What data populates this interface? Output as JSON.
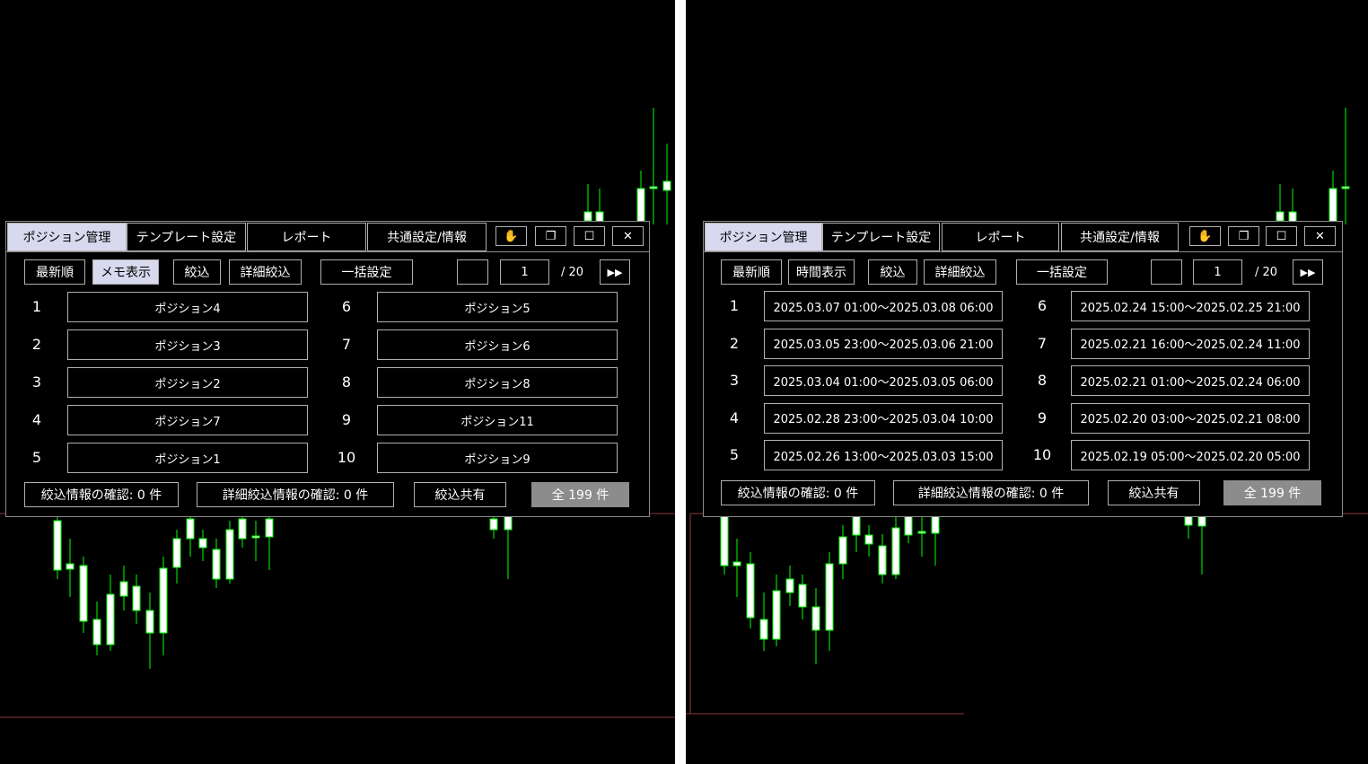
{
  "left": {
    "tabs": [
      "ポジション管理",
      "テンプレート設定",
      "レポート",
      "共通設定/情報"
    ],
    "toolbar": {
      "sort": "最新順",
      "display": "メモ表示",
      "filter": "絞込",
      "detail_filter": "詳細絞込",
      "bulk": "一括設定",
      "page_current": "1",
      "page_total": "/ 20"
    },
    "rows_left": [
      {
        "num": "1",
        "label": "ポジション4"
      },
      {
        "num": "2",
        "label": "ポジション3"
      },
      {
        "num": "3",
        "label": "ポジション2"
      },
      {
        "num": "4",
        "label": "ポジション7"
      },
      {
        "num": "5",
        "label": "ポジション1"
      }
    ],
    "rows_right": [
      {
        "num": "6",
        "label": "ポジション5"
      },
      {
        "num": "7",
        "label": "ポジション6"
      },
      {
        "num": "8",
        "label": "ポジション8"
      },
      {
        "num": "9",
        "label": "ポジション11"
      },
      {
        "num": "10",
        "label": "ポジション9"
      }
    ],
    "footer": {
      "filter_info": "絞込情報の確認: 0 件",
      "detail_info": "詳細絞込情報の確認: 0 件",
      "share": "絞込共有",
      "total": "全 199 件"
    }
  },
  "right": {
    "tabs": [
      "ポジション管理",
      "テンプレート設定",
      "レポート",
      "共通設定/情報"
    ],
    "toolbar": {
      "sort": "最新順",
      "display": "時間表示",
      "filter": "絞込",
      "detail_filter": "詳細絞込",
      "bulk": "一括設定",
      "page_current": "1",
      "page_total": "/ 20"
    },
    "rows_left": [
      {
        "num": "1",
        "label": "2025.03.07 01:00～2025.03.08 06:00"
      },
      {
        "num": "2",
        "label": "2025.03.05 23:00～2025.03.06 21:00"
      },
      {
        "num": "3",
        "label": "2025.03.04 01:00～2025.03.05 06:00"
      },
      {
        "num": "4",
        "label": "2025.02.28 23:00～2025.03.04 10:00"
      },
      {
        "num": "5",
        "label": "2025.02.26 13:00～2025.03.03 15:00"
      }
    ],
    "rows_right": [
      {
        "num": "6",
        "label": "2025.02.24 15:00～2025.02.25 21:00"
      },
      {
        "num": "7",
        "label": "2025.02.21 16:00～2025.02.24 11:00"
      },
      {
        "num": "8",
        "label": "2025.02.21 01:00～2025.02.24 06:00"
      },
      {
        "num": "9",
        "label": "2025.02.20 03:00～2025.02.21 08:00"
      },
      {
        "num": "10",
        "label": "2025.02.19 05:00～2025.02.20 05:00"
      }
    ],
    "footer": {
      "filter_info": "絞込情報の確認: 0 件",
      "detail_info": "詳細絞込情報の確認: 0 件",
      "share": "絞込共有",
      "total": "全 199 件"
    }
  },
  "icons": [
    "hand-icon",
    "restore-icon",
    "maximize-icon",
    "close-icon",
    "fast-forward-icon"
  ],
  "colors": {
    "background": "#000000",
    "candle_wick": "#00ff00",
    "candle_body": "#ffffff",
    "active_tab": "#d8d8ee",
    "total_button": "#8c8c8c",
    "level_line": "#8b3a3a"
  }
}
